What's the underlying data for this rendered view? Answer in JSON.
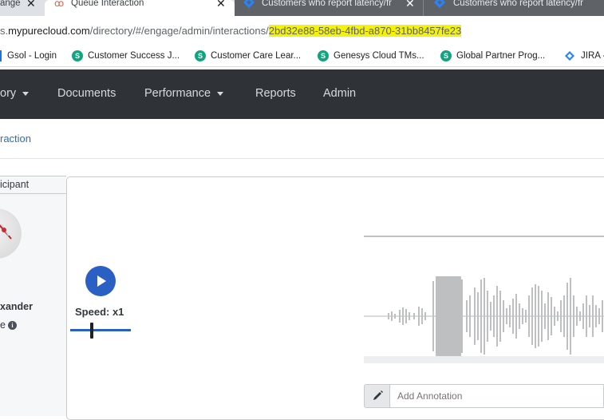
{
  "browser": {
    "tabs": [
      {
        "label": "ange",
        "state": "inactive"
      },
      {
        "label": "Queue Interaction",
        "state": "active"
      },
      {
        "label": "Customers who report latency/fr",
        "state": "dark"
      },
      {
        "label": "Customers who report latency/fr",
        "state": "dark"
      }
    ],
    "close_glyph": "✕",
    "address": {
      "prefix": "s.",
      "domain": "mypurecloud.com",
      "path": "/directory/#/engage/admin/interactions/",
      "highlighted_id": "2bd32e88-58eb-4fbd-a870-31bb8457fe23",
      "highlight_color": "#f5f20a"
    },
    "bookmarks": [
      {
        "label": "Gsol - Login",
        "icon": "bookmark-divider-icon"
      },
      {
        "label": "Customer Success J...",
        "icon": "skilljar-icon"
      },
      {
        "label": "Customer Care Lear...",
        "icon": "skilljar-icon"
      },
      {
        "label": "Genesys Cloud TMs...",
        "icon": "skilljar-icon"
      },
      {
        "label": "Global Partner Prog...",
        "icon": "skilljar-icon"
      },
      {
        "label": "JIRA -",
        "icon": "jira-icon"
      }
    ]
  },
  "nav": {
    "items": [
      {
        "label": "ory",
        "has_caret": true
      },
      {
        "label": "Documents",
        "has_caret": false
      },
      {
        "label": "Performance",
        "has_caret": true
      },
      {
        "label": "Reports",
        "has_caret": false
      },
      {
        "label": "Admin",
        "has_caret": false
      }
    ],
    "background": "#2f3338"
  },
  "breadcrumb": {
    "label": "raction"
  },
  "participant": {
    "header": "icipant",
    "name": "xander",
    "status": "e"
  },
  "player": {
    "speed_label": "Speed: x1",
    "speed_value": 1,
    "accent": "#2a5fc4"
  },
  "annotation": {
    "placeholder": "Add Annotation"
  }
}
